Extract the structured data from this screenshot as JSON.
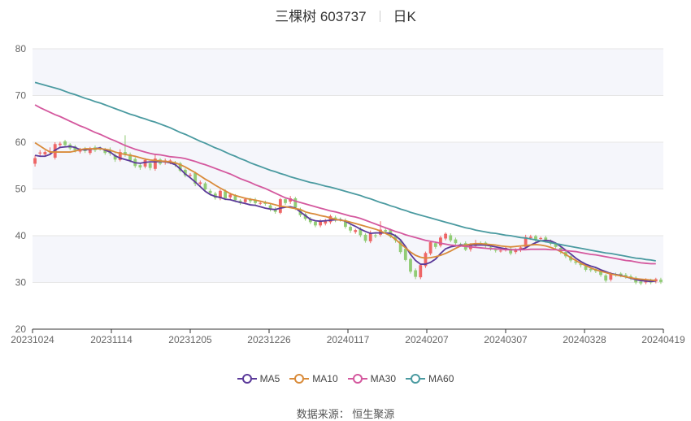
{
  "title": {
    "stock": "三棵树 603737",
    "period": "日K"
  },
  "source": "数据来源：  恒生聚源",
  "chart_data": {
    "type": "candlestick",
    "ylim": [
      20,
      80
    ],
    "yticks": [
      20,
      30,
      40,
      50,
      60,
      70,
      80
    ],
    "xticks": [
      "20231024",
      "20231114",
      "20231205",
      "20231226",
      "20240117",
      "20240207",
      "20240307",
      "20240328",
      "20240419"
    ],
    "colors": {
      "up": "#ee6666",
      "down": "#91cc75",
      "band": "#f5f6fb",
      "grid": "#e6e6e6",
      "axis": "#333333"
    },
    "candles": [
      [
        55.4,
        56.6,
        54.8,
        57.2
      ],
      [
        57.6,
        57.8,
        56.9,
        58.3
      ],
      [
        57.4,
        57.9,
        57.0,
        58.2
      ],
      [
        58.0,
        58.1,
        57.3,
        58.9
      ],
      [
        56.7,
        59.6,
        56.3,
        60.0
      ],
      [
        59.4,
        59.7,
        58.7,
        60.1
      ],
      [
        60.2,
        59.4,
        58.9,
        60.5
      ],
      [
        59.5,
        58.7,
        58.3,
        59.8
      ],
      [
        59.1,
        58.3,
        57.8,
        59.4
      ],
      [
        58.0,
        58.4,
        57.6,
        58.8
      ],
      [
        58.6,
        58.1,
        57.7,
        59.0
      ],
      [
        57.7,
        58.6,
        57.3,
        59.0
      ],
      [
        58.9,
        58.3,
        57.9,
        59.3
      ],
      [
        58.7,
        58.6,
        58.2,
        59.1
      ],
      [
        58.4,
        57.7,
        57.3,
        58.8
      ],
      [
        58.3,
        57.6,
        57.1,
        58.9
      ],
      [
        57.2,
        56.3,
        55.8,
        57.6
      ],
      [
        56.2,
        57.9,
        55.9,
        58.5
      ],
      [
        57.9,
        57.5,
        56.9,
        61.5
      ],
      [
        57.4,
        56.1,
        55.7,
        57.8
      ],
      [
        56.4,
        54.9,
        54.5,
        56.8
      ],
      [
        55.1,
        54.6,
        54.1,
        55.5
      ],
      [
        54.8,
        56.2,
        54.4,
        56.6
      ],
      [
        55.5,
        54.5,
        54.0,
        55.9
      ],
      [
        54.3,
        56.5,
        53.9,
        57.5
      ],
      [
        56.3,
        55.4,
        55.1,
        56.6
      ],
      [
        55.7,
        56.1,
        55.2,
        56.5
      ],
      [
        55.8,
        56.1,
        55.3,
        56.4
      ],
      [
        55.6,
        55.2,
        54.7,
        56.0
      ],
      [
        55.5,
        53.9,
        53.6,
        55.8
      ],
      [
        54.1,
        52.9,
        52.5,
        54.4
      ],
      [
        52.9,
        53.0,
        52.4,
        53.4
      ],
      [
        53.4,
        51.1,
        50.6,
        53.7
      ],
      [
        51.1,
        51.4,
        50.7,
        51.8
      ],
      [
        51.2,
        49.9,
        49.5,
        51.5
      ],
      [
        49.6,
        49.1,
        48.6,
        50.0
      ],
      [
        49.0,
        48.1,
        47.7,
        49.4
      ],
      [
        48.0,
        49.6,
        47.6,
        49.9
      ],
      [
        49.5,
        48.0,
        47.6,
        49.9
      ],
      [
        48.2,
        48.8,
        47.8,
        49.2
      ],
      [
        48.5,
        47.6,
        47.2,
        48.9
      ],
      [
        47.5,
        47.0,
        46.6,
        47.8
      ],
      [
        47.2,
        47.8,
        46.7,
        48.2
      ],
      [
        47.7,
        47.4,
        46.9,
        48.1
      ],
      [
        47.7,
        47.0,
        46.6,
        48.1
      ],
      [
        46.9,
        47.0,
        46.6,
        47.4
      ],
      [
        47.2,
        46.8,
        46.4,
        47.5
      ],
      [
        46.5,
        45.6,
        45.2,
        46.9
      ],
      [
        45.7,
        45.1,
        44.7,
        46.1
      ],
      [
        44.9,
        47.8,
        44.6,
        48.1
      ],
      [
        47.8,
        47.0,
        46.6,
        48.1
      ],
      [
        47.3,
        48.0,
        46.8,
        48.5
      ],
      [
        48.0,
        46.0,
        45.5,
        48.3
      ],
      [
        45.6,
        44.4,
        44.0,
        46.0
      ],
      [
        44.6,
        43.6,
        43.2,
        44.9
      ],
      [
        43.6,
        42.9,
        42.5,
        44.0
      ],
      [
        43.0,
        42.2,
        41.8,
        43.3
      ],
      [
        42.2,
        43.1,
        41.8,
        43.5
      ],
      [
        42.6,
        43.2,
        42.2,
        43.6
      ],
      [
        42.9,
        44.2,
        42.5,
        44.5
      ],
      [
        43.9,
        43.3,
        42.9,
        44.3
      ],
      [
        43.5,
        43.4,
        43.0,
        43.9
      ],
      [
        43.3,
        41.9,
        41.5,
        43.7
      ],
      [
        41.9,
        41.1,
        40.6,
        42.3
      ],
      [
        40.8,
        41.2,
        40.4,
        41.5
      ],
      [
        41.4,
        40.1,
        39.7,
        41.8
      ],
      [
        40.2,
        38.9,
        38.5,
        40.5
      ],
      [
        38.8,
        40.6,
        38.4,
        41.1
      ],
      [
        40.1,
        39.9,
        39.5,
        40.4
      ],
      [
        40.2,
        41.3,
        39.8,
        43.1
      ],
      [
        41.2,
        40.9,
        40.5,
        41.6
      ],
      [
        41.2,
        39.8,
        39.5,
        41.5
      ],
      [
        40.0,
        39.0,
        38.5,
        40.3
      ],
      [
        38.9,
        36.5,
        36.1,
        39.3
      ],
      [
        37.2,
        34.8,
        34.5,
        37.5
      ],
      [
        35.0,
        32.3,
        31.9,
        35.3
      ],
      [
        32.6,
        31.2,
        30.7,
        33.0
      ],
      [
        31.1,
        33.7,
        30.7,
        34.0
      ],
      [
        33.5,
        36.3,
        33.1,
        36.6
      ],
      [
        36.2,
        38.6,
        35.8,
        38.9
      ],
      [
        38.4,
        37.6,
        37.2,
        38.8
      ],
      [
        37.9,
        39.6,
        37.5,
        40.0
      ],
      [
        39.4,
        40.4,
        39.0,
        40.7
      ],
      [
        40.1,
        39.0,
        38.6,
        40.5
      ],
      [
        39.2,
        38.4,
        38.0,
        39.6
      ],
      [
        38.2,
        38.1,
        37.6,
        38.5
      ],
      [
        38.4,
        37.0,
        36.7,
        38.8
      ],
      [
        37.1,
        38.0,
        36.6,
        38.4
      ],
      [
        37.8,
        38.4,
        37.5,
        39.1
      ],
      [
        38.4,
        38.3,
        37.9,
        38.8
      ],
      [
        38.5,
        37.8,
        37.4,
        38.8
      ],
      [
        37.5,
        37.2,
        36.8,
        37.9
      ],
      [
        37.0,
        36.8,
        36.4,
        37.3
      ],
      [
        36.8,
        36.8,
        36.4,
        37.2
      ],
      [
        37.0,
        37.4,
        36.6,
        37.8
      ],
      [
        37.2,
        36.2,
        35.8,
        37.6
      ],
      [
        36.5,
        36.9,
        36.1,
        37.3
      ],
      [
        36.9,
        37.5,
        36.5,
        37.9
      ],
      [
        37.6,
        39.7,
        37.2,
        40.2
      ],
      [
        39.5,
        39.8,
        39.1,
        40.2
      ],
      [
        39.9,
        39.1,
        38.7,
        40.2
      ],
      [
        39.3,
        39.5,
        38.9,
        39.8
      ],
      [
        39.6,
        38.9,
        38.5,
        40.0
      ],
      [
        38.8,
        38.3,
        37.9,
        39.2
      ],
      [
        38.2,
        37.6,
        37.2,
        38.6
      ],
      [
        37.4,
        36.5,
        36.1,
        37.8
      ],
      [
        36.5,
        35.6,
        35.2,
        36.8
      ],
      [
        35.6,
        34.7,
        34.3,
        35.9
      ],
      [
        34.5,
        34.2,
        33.8,
        34.9
      ],
      [
        34.0,
        33.7,
        33.2,
        34.3
      ],
      [
        33.5,
        32.7,
        32.3,
        33.9
      ],
      [
        32.9,
        32.6,
        32.2,
        33.2
      ],
      [
        32.9,
        32.4,
        32.0,
        33.2
      ],
      [
        32.5,
        31.6,
        31.2,
        32.8
      ],
      [
        31.5,
        30.4,
        30.0,
        31.8
      ],
      [
        30.6,
        31.8,
        30.2,
        32.2
      ],
      [
        31.7,
        31.6,
        31.2,
        32.1
      ],
      [
        31.9,
        31.5,
        31.1,
        32.2
      ],
      [
        31.6,
        31.2,
        30.8,
        32.0
      ],
      [
        31.3,
        30.9,
        30.5,
        31.7
      ],
      [
        31.0,
        30.0,
        29.6,
        31.3
      ],
      [
        30.2,
        29.8,
        29.4,
        30.6
      ],
      [
        30.0,
        30.5,
        29.6,
        30.9
      ],
      [
        30.5,
        30.0,
        29.6,
        30.8
      ],
      [
        30.2,
        30.7,
        29.8,
        31.0
      ],
      [
        30.6,
        30.1,
        29.7,
        31.0
      ]
    ],
    "series": [
      {
        "name": "MA5",
        "color": "#5b3a9a",
        "values": [
          57.2,
          57.0,
          57.0,
          57.4,
          58.3,
          58.9,
          59.0,
          59.1,
          58.9,
          58.4,
          58.4,
          58.5,
          58.6,
          58.8,
          58.3,
          57.9,
          57.1,
          56.6,
          56.3,
          56.0,
          55.6,
          55.5,
          55.7,
          55.8,
          55.8,
          55.9,
          55.8,
          55.6,
          55.2,
          54.3,
          53.2,
          52.4,
          51.5,
          50.5,
          49.5,
          48.8,
          48.4,
          48.2,
          47.8,
          47.7,
          47.4,
          47.1,
          46.9,
          46.6,
          46.5,
          46.2,
          45.9,
          45.7,
          45.6,
          45.9,
          46.1,
          46.2,
          45.9,
          45.1,
          44.3,
          43.5,
          43.2,
          43.1,
          43.2,
          43.3,
          43.4,
          43.4,
          43.1,
          42.5,
          42.0,
          41.4,
          40.9,
          40.5,
          40.6,
          40.6,
          40.6,
          40.5,
          40.0,
          39.1,
          37.7,
          36.0,
          34.7,
          33.9,
          33.9,
          34.3,
          35.0,
          36.2,
          37.2,
          37.6,
          37.8,
          38.0,
          38.0,
          38.0,
          38.0,
          38.0,
          38.0,
          37.8,
          37.6,
          37.4,
          37.2,
          37.0,
          37.0,
          37.0,
          37.4,
          38.0,
          38.5,
          38.9,
          39.0,
          38.9,
          38.4,
          37.7,
          36.9,
          36.1,
          35.2,
          34.5,
          33.9,
          33.5,
          33.2,
          32.7,
          32.3,
          31.9,
          31.7,
          31.5,
          31.2,
          30.9,
          30.6,
          30.4,
          30.3,
          30.2,
          30.3
        ]
      },
      {
        "name": "MA10",
        "color": "#d98b3a",
        "values": [
          59.9,
          59.2,
          58.5,
          57.9,
          57.9,
          57.9,
          57.9,
          57.9,
          58.1,
          58.4,
          58.6,
          58.6,
          58.6,
          58.6,
          58.5,
          58.3,
          57.9,
          57.6,
          57.4,
          57.2,
          57.0,
          56.7,
          56.4,
          56.2,
          56.1,
          56.0,
          55.9,
          55.8,
          55.6,
          55.2,
          54.7,
          54.1,
          53.5,
          52.8,
          52.1,
          51.5,
          50.8,
          50.2,
          49.6,
          49.0,
          48.6,
          48.3,
          48.0,
          47.8,
          47.6,
          47.4,
          47.1,
          46.9,
          46.6,
          46.3,
          46.2,
          46.0,
          45.8,
          45.6,
          45.1,
          44.8,
          44.6,
          44.3,
          44.1,
          43.8,
          43.5,
          43.3,
          43.2,
          42.9,
          42.6,
          42.3,
          42.0,
          41.7,
          41.4,
          41.0,
          40.5,
          40.0,
          39.2,
          38.3,
          37.4,
          36.5,
          35.8,
          35.4,
          35.2,
          35.3,
          35.5,
          35.8,
          36.2,
          36.7,
          37.3,
          37.8,
          38.0,
          38.2,
          38.3,
          38.3,
          38.2,
          38.1,
          38.0,
          37.8,
          37.7,
          37.6,
          37.7,
          37.8,
          37.9,
          38.0,
          38.1,
          38.0,
          37.8,
          37.5,
          37.1,
          36.6,
          36.0,
          35.3,
          34.7,
          34.1,
          33.6,
          33.1,
          32.7,
          32.4,
          32.1,
          31.8,
          31.6,
          31.4,
          31.2,
          31.0,
          30.8,
          30.7,
          30.6,
          30.5,
          30.4
        ]
      },
      {
        "name": "MA30",
        "color": "#d4589e",
        "values": [
          68.0,
          67.4,
          66.9,
          66.4,
          65.9,
          65.5,
          65.0,
          64.5,
          64.0,
          63.5,
          63.1,
          62.6,
          62.1,
          61.7,
          61.2,
          60.7,
          60.3,
          59.8,
          59.3,
          58.9,
          58.5,
          58.2,
          57.9,
          57.6,
          57.4,
          57.3,
          57.1,
          56.9,
          56.8,
          56.7,
          56.5,
          56.2,
          55.9,
          55.5,
          55.2,
          54.8,
          54.4,
          54.0,
          53.6,
          53.2,
          52.7,
          52.2,
          51.8,
          51.4,
          50.9,
          50.5,
          50.1,
          49.6,
          49.1,
          48.6,
          48.1,
          47.8,
          47.4,
          47.1,
          46.8,
          46.5,
          46.2,
          45.9,
          45.6,
          45.3,
          45.1,
          44.8,
          44.5,
          44.2,
          44.0,
          43.7,
          43.3,
          42.9,
          42.5,
          42.1,
          41.7,
          41.3,
          40.9,
          40.6,
          40.2,
          39.9,
          39.6,
          39.3,
          39.0,
          38.8,
          38.6,
          38.4,
          38.2,
          38.0,
          37.9,
          37.8,
          37.7,
          37.6,
          37.5,
          37.4,
          37.3,
          37.2,
          37.2,
          37.1,
          37.0,
          37.0,
          37.0,
          37.0,
          37.0,
          37.1,
          37.1,
          37.1,
          37.1,
          37.0,
          37.0,
          36.9,
          36.8,
          36.7,
          36.6,
          36.4,
          36.2,
          36.0,
          35.9,
          35.7,
          35.5,
          35.3,
          35.1,
          34.9,
          34.7,
          34.6,
          34.4,
          34.2,
          34.1,
          34.0,
          34.0
        ]
      },
      {
        "name": "MA60",
        "color": "#4a9aa0",
        "values": [
          72.8,
          72.5,
          72.2,
          71.9,
          71.6,
          71.3,
          70.9,
          70.5,
          70.2,
          69.8,
          69.4,
          69.1,
          68.7,
          68.4,
          68.0,
          67.6,
          67.2,
          66.8,
          66.4,
          66.0,
          65.7,
          65.3,
          65.0,
          64.6,
          64.3,
          63.9,
          63.5,
          63.1,
          62.6,
          62.1,
          61.7,
          61.2,
          60.7,
          60.2,
          59.8,
          59.3,
          58.8,
          58.4,
          57.9,
          57.4,
          57.0,
          56.5,
          56.1,
          55.6,
          55.2,
          54.8,
          54.4,
          54.0,
          53.7,
          53.3,
          53.0,
          52.6,
          52.3,
          52.0,
          51.7,
          51.4,
          51.2,
          50.9,
          50.6,
          50.4,
          50.1,
          49.8,
          49.5,
          49.2,
          48.9,
          48.6,
          48.2,
          47.9,
          47.5,
          47.1,
          46.8,
          46.4,
          46.1,
          45.7,
          45.4,
          45.0,
          44.7,
          44.4,
          44.1,
          43.8,
          43.5,
          43.2,
          42.9,
          42.6,
          42.3,
          42.0,
          41.7,
          41.5,
          41.2,
          41.0,
          40.8,
          40.6,
          40.5,
          40.3,
          40.1,
          40.0,
          39.8,
          39.6,
          39.5,
          39.3,
          39.1,
          38.9,
          38.7,
          38.5,
          38.3,
          38.1,
          37.9,
          37.7,
          37.5,
          37.3,
          37.1,
          36.9,
          36.7,
          36.5,
          36.3,
          36.2,
          36.0,
          35.8,
          35.6,
          35.4,
          35.2,
          35.1,
          34.9,
          34.8,
          34.6
        ]
      }
    ],
    "legend": {
      "position": "bottom-center",
      "items": [
        "MA5",
        "MA10",
        "MA30",
        "MA60"
      ]
    }
  }
}
